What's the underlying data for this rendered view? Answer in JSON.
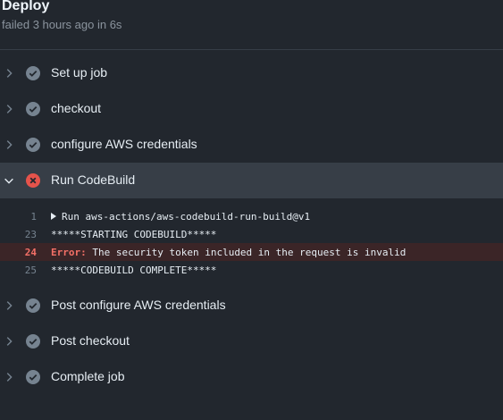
{
  "job": {
    "title": "Deploy",
    "status": "failed 3 hours ago in 6s"
  },
  "colors": {
    "background": "#22272e",
    "success": "#768390",
    "failure": "#e5534b",
    "error_text": "#f47067"
  },
  "steps_before": [
    {
      "label": "Set up job",
      "status": "success",
      "icon": "check-circle-icon"
    },
    {
      "label": "checkout",
      "status": "success",
      "icon": "check-circle-icon"
    },
    {
      "label": "configure AWS credentials",
      "status": "success",
      "icon": "check-circle-icon"
    }
  ],
  "expanded_step": {
    "label": "Run CodeBuild",
    "status": "failure",
    "icon": "x-circle-icon",
    "log": [
      {
        "line": "1",
        "text": "Run aws-actions/aws-codebuild-run-build@v1",
        "collapsible": true
      },
      {
        "line": "23",
        "text": "*****STARTING CODEBUILD*****"
      },
      {
        "line": "24",
        "error_prefix": "Error:",
        "text": " The security token included in the request is invalid",
        "error": true
      },
      {
        "line": "25",
        "text": "*****CODEBUILD COMPLETE*****"
      }
    ]
  },
  "steps_after": [
    {
      "label": "Post configure AWS credentials",
      "status": "success",
      "icon": "check-circle-icon"
    },
    {
      "label": "Post checkout",
      "status": "success",
      "icon": "check-circle-icon"
    },
    {
      "label": "Complete job",
      "status": "success",
      "icon": "check-circle-icon"
    }
  ]
}
